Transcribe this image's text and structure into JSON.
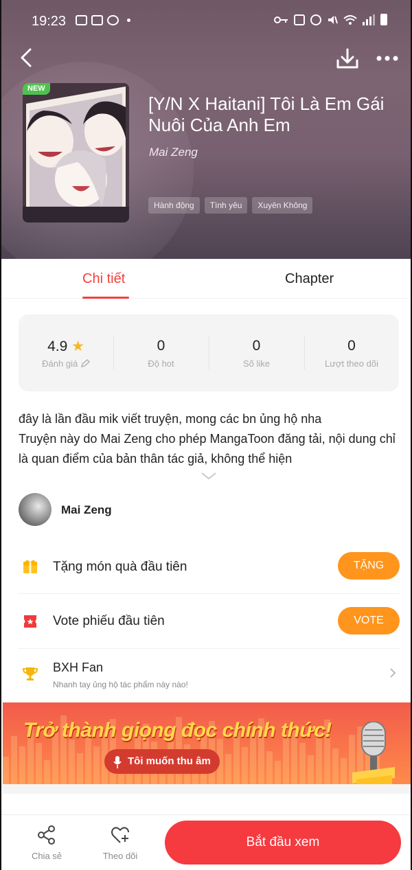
{
  "status_bar": {
    "time": "19:23",
    "left_icons": [
      "teams-icon",
      "image-icon",
      "messenger-icon",
      "dot-icon"
    ],
    "right_icons": [
      "key-icon",
      "lock-icon",
      "alarm-icon",
      "mute-icon",
      "wifi-icon",
      "signal-icon",
      "battery-icon"
    ]
  },
  "header": {
    "back_icon": "chevron-left-icon",
    "download_icon": "download-icon",
    "more_icon": "more-icon",
    "badge": "NEW",
    "title": "[Y/N X Haitani] Tôi Là Em Gái Nuôi Của Anh Em",
    "author": "Mai Zeng",
    "tags": [
      "Hành động",
      "Tình yêu",
      "Xuyên Không"
    ]
  },
  "tabs": [
    {
      "label": "Chi tiết",
      "active": true
    },
    {
      "label": "Chapter",
      "active": false
    }
  ],
  "stats": [
    {
      "value": "4.9",
      "label": "Đánh giá"
    },
    {
      "value": "0",
      "label": "Độ hot"
    },
    {
      "value": "0",
      "label": "Số like"
    },
    {
      "value": "0",
      "label": "Lượt theo dõi"
    }
  ],
  "description": {
    "line1": "đây là lần đầu mik viết truyện, mong các bn ủng hộ nha",
    "line2": "Truyện này do Mai Zeng cho phép MangaToon đăng tải, nội dung chỉ là quan điểm của bản thân tác giả, không thể hiện"
  },
  "author_row": {
    "name": "Mai Zeng"
  },
  "actions": {
    "gift": {
      "label": "Tặng món quà đầu tiên",
      "button": "TẶNG"
    },
    "vote": {
      "label": "Vote phiếu đầu tiên",
      "button": "VOTE"
    },
    "fan": {
      "label": "BXH Fan",
      "sub": "Nhanh tay ủng hộ tác phẩm này nào!"
    }
  },
  "banner": {
    "title": "Trở thành giọng đọc chính thức!",
    "button": "Tôi muốn thu âm"
  },
  "bottom_bar": {
    "share": "Chia sẻ",
    "follow": "Theo dõi",
    "start": "Bắt đầu xem"
  },
  "colors": {
    "accent": "#f2403a",
    "orange": "#ff951c",
    "start_button": "#f53a40"
  }
}
